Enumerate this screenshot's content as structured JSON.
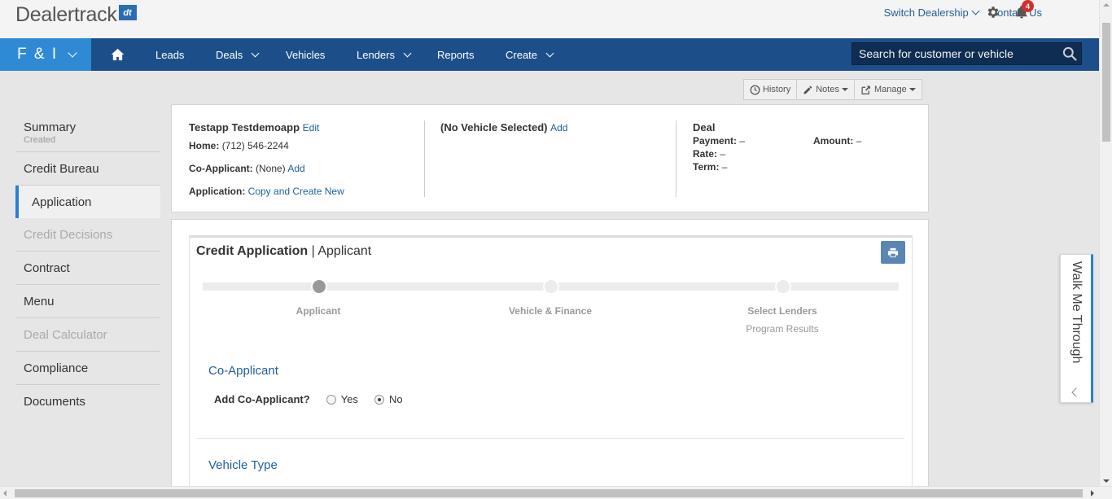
{
  "brand": {
    "logo_text": "Dealertrack",
    "logo_badge": "dt"
  },
  "top_links": {
    "switch_dealership": "Switch Dealership",
    "contact_us": "Contact Us",
    "notification_count": "4"
  },
  "navbar": {
    "module": "F & I",
    "items": [
      {
        "label": "Leads"
      },
      {
        "label": "Deals"
      },
      {
        "label": "Vehicles"
      },
      {
        "label": "Lenders"
      },
      {
        "label": "Reports"
      },
      {
        "label": "Create"
      }
    ],
    "search_placeholder": "Search for customer or vehicle"
  },
  "toolbar": {
    "history": "History",
    "notes": "Notes",
    "manage": "Manage"
  },
  "sidebar": {
    "summary": {
      "label": "Summary",
      "sub": "Created"
    },
    "items": [
      {
        "label": "Credit Bureau"
      },
      {
        "label": "Application"
      },
      {
        "label": "Credit Decisions"
      },
      {
        "label": "Contract"
      },
      {
        "label": "Menu"
      },
      {
        "label": "Deal Calculator"
      },
      {
        "label": "Compliance"
      },
      {
        "label": "Documents"
      }
    ]
  },
  "header": {
    "customer_name": "Testapp Testdemoapp",
    "edit": "Edit",
    "home_label": "Home:",
    "home_phone": "(712) 546-2244",
    "coapp_label": "Co-Applicant:",
    "coapp_value": "(None)",
    "coapp_add": "Add",
    "application_label": "Application:",
    "application_link": "Copy and Create New",
    "vehicle_title": "(No Vehicle Selected)",
    "vehicle_add": "Add",
    "deal_title": "Deal",
    "payment_label": "Payment:",
    "payment_value": "–",
    "amount_label": "Amount:",
    "amount_value": "–",
    "rate_label": "Rate:",
    "rate_value": "–",
    "term_label": "Term:",
    "term_value": "–"
  },
  "credit_app": {
    "title": "Credit Application",
    "subtitle": "| Applicant",
    "steps": [
      {
        "label": "Applicant",
        "sub": ""
      },
      {
        "label": "Vehicle & Finance",
        "sub": ""
      },
      {
        "label": "Select Lenders",
        "sub": "Program Results"
      }
    ],
    "coapplicant_section": "Co-Applicant",
    "add_coapplicant_label": "Add Co-Applicant?",
    "yes_label": "Yes",
    "no_label": "No",
    "vehicle_type_section": "Vehicle Type"
  },
  "walkme": {
    "label": "Walk Me Through"
  },
  "colors": {
    "nav_blue": "#1c4f8a",
    "module_blue": "#2f8ad6",
    "link_blue": "#1f5f9e",
    "accent_blue": "#2a7fd4"
  }
}
